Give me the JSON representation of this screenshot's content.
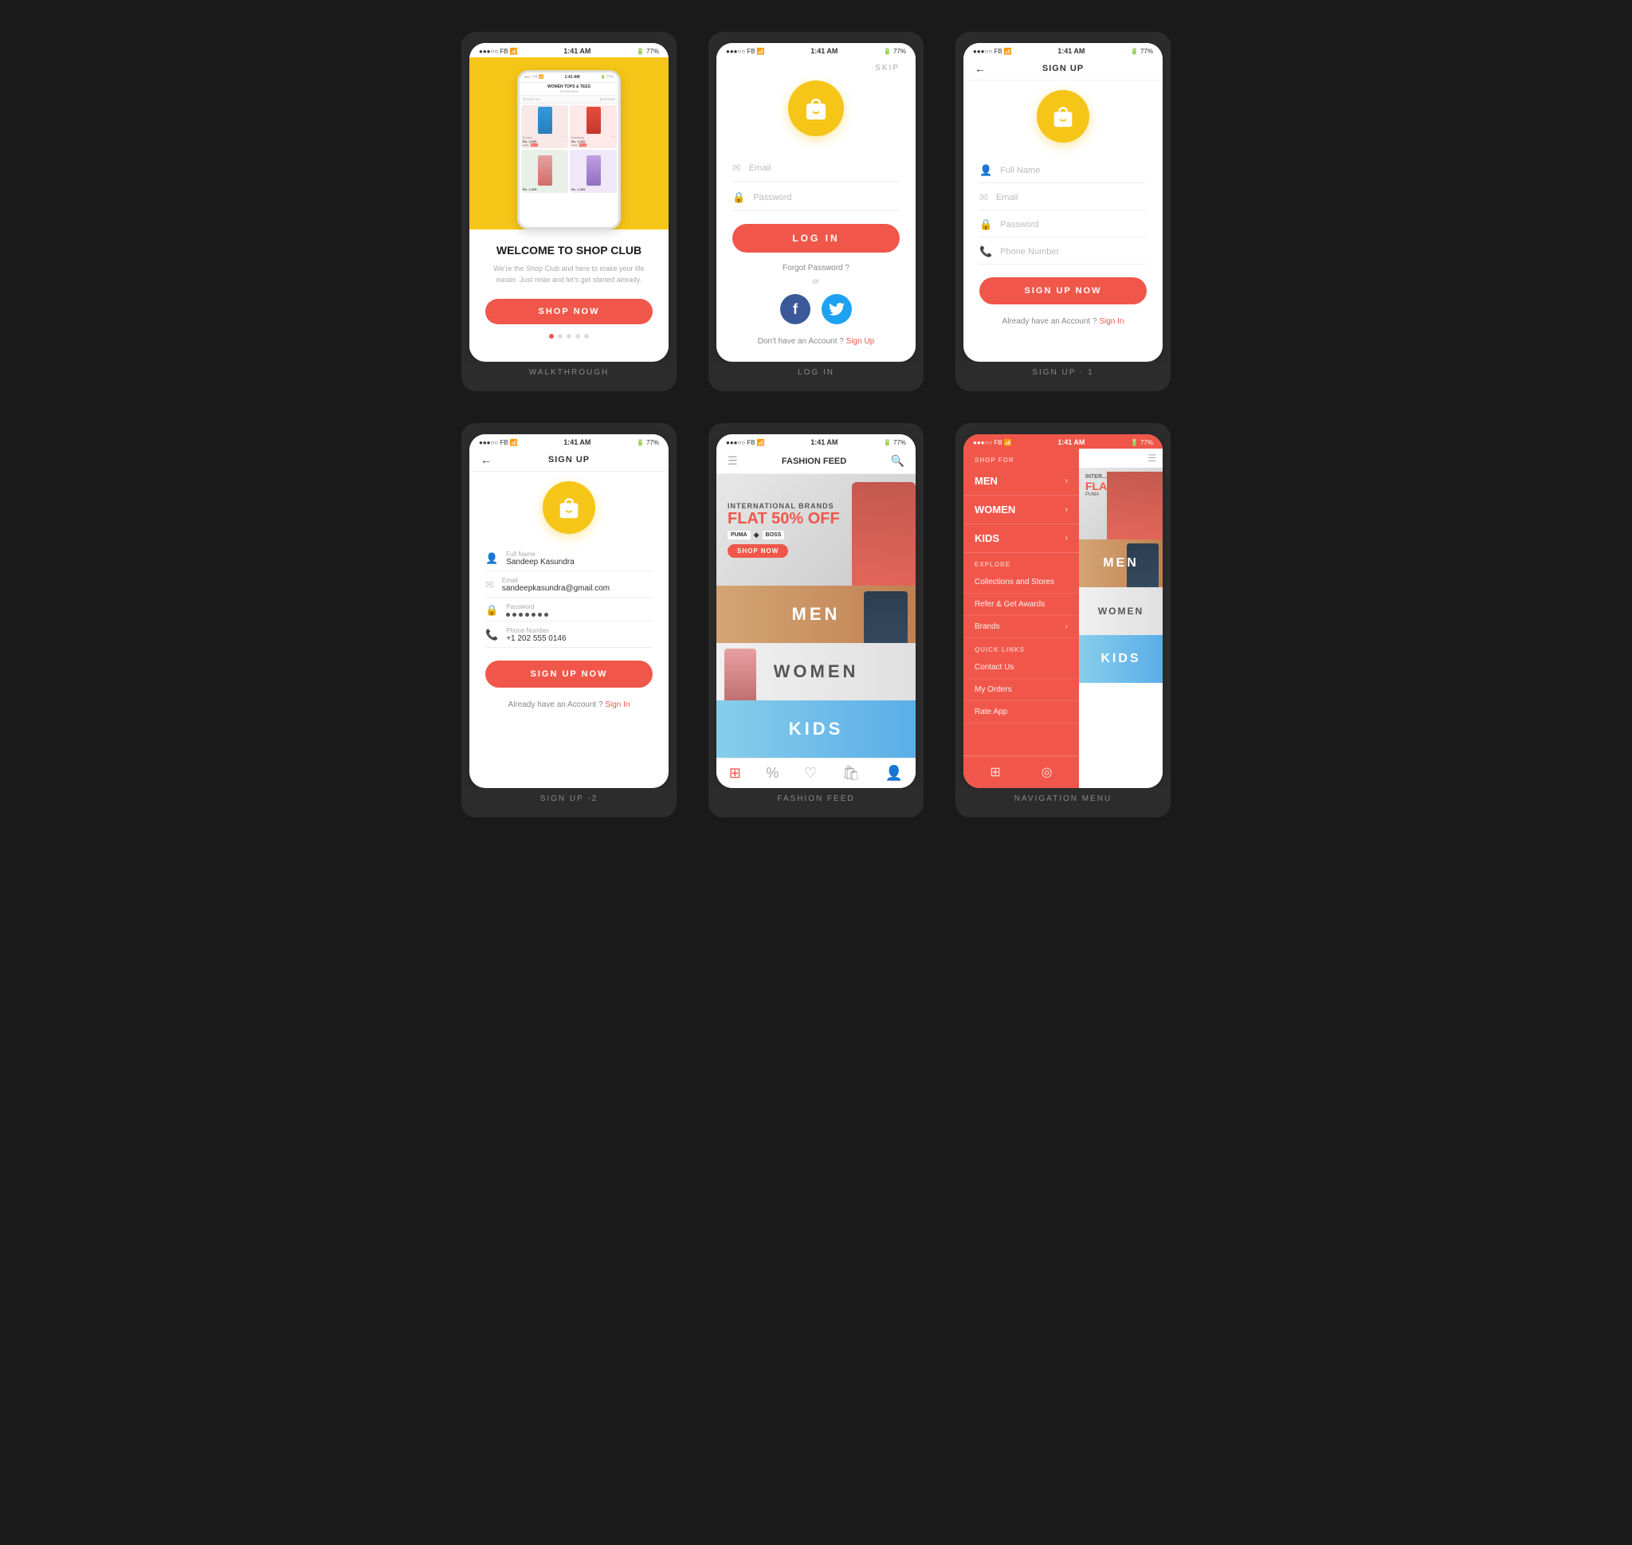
{
  "screens": {
    "walkthrough": {
      "label": "WALKTHROUGH",
      "status": {
        "left": "●●●○○ FB 🌐",
        "time": "1:41 AM",
        "right": "🔋 77%"
      },
      "phone_label": "WOMEN TOPS & TEES",
      "phone_sub": "12,325 items",
      "title": "WELCOME TO SHOP CLUB",
      "description": "We're the Shop Club and here to make your life easier. Just relax and let's get started already.",
      "btn_label": "SHOP NOW"
    },
    "login": {
      "label": "LOG IN",
      "status": {
        "left": "●●●○○ FB 🌐",
        "time": "1:41 AM",
        "right": "🔋 77%"
      },
      "skip": "SKIP",
      "email_placeholder": "Email",
      "password_placeholder": "Password",
      "btn_label": "LOG IN",
      "forgot": "Forgot Password ?",
      "or": "or",
      "no_account": "Don't have an Account ?",
      "sign_up": "Sign Up"
    },
    "signup1": {
      "label": "SIGN UP · 1",
      "status": {
        "left": "●●●○○ FB 🌐",
        "time": "1:41 AM",
        "right": "🔋 77%"
      },
      "header": "SIGN UP",
      "fullname_placeholder": "Full Name",
      "email_placeholder": "Email",
      "password_placeholder": "Password",
      "phone_placeholder": "Phone Number",
      "btn_label": "SIGN UP NOW",
      "have_account": "Already have an Account ?",
      "sign_in": "Sign In"
    },
    "signup2": {
      "label": "SIGN UP -2",
      "status": {
        "left": "●●●○○ FB 🌐",
        "time": "1:41 AM",
        "right": "🔋 77%"
      },
      "header": "SIGN UP",
      "fullname": "Sandeep Kasundra",
      "email": "sandeepkasundra@gmail.com",
      "password_label": "Password",
      "phone_label": "Phone Number",
      "phone": "+1 202 555 0146",
      "btn_label": "SIGN UP NOW",
      "have_account": "Already have an Account ?",
      "sign_in": "Sign In"
    },
    "fashion": {
      "label": "FASHION FEED",
      "status": {
        "left": "●●●○○ FB 🌐",
        "time": "1:41 AM",
        "right": "🔋 77%"
      },
      "title": "FASHION FEED",
      "banner_brand": "INTERNATIONAL BRANDS",
      "banner_discount": "FLAT 50% OFF",
      "shop_btn": "SHOP NOW",
      "brands": [
        "PUMA",
        "◆",
        "BOSS"
      ],
      "sections": [
        "MEN",
        "WOMEN",
        "KIDS"
      ]
    },
    "nav_menu": {
      "label": "NAVIGATION MENU",
      "status": {
        "left": "●●●○○ FB 🌐",
        "time": "1:41 AM",
        "right": "🔋 77%"
      },
      "shop_for": "SHOP FOR",
      "items": [
        "MEN",
        "WOMEN",
        "KIDS"
      ],
      "explore_header": "EXPLORE",
      "explore_items": [
        "Collections and Stores",
        "Refer & Get Awards",
        "Brands"
      ],
      "quick_links_header": "QUICK LINKS",
      "quick_links": [
        "Contact Us",
        "My Orders",
        "Rate App"
      ]
    }
  }
}
